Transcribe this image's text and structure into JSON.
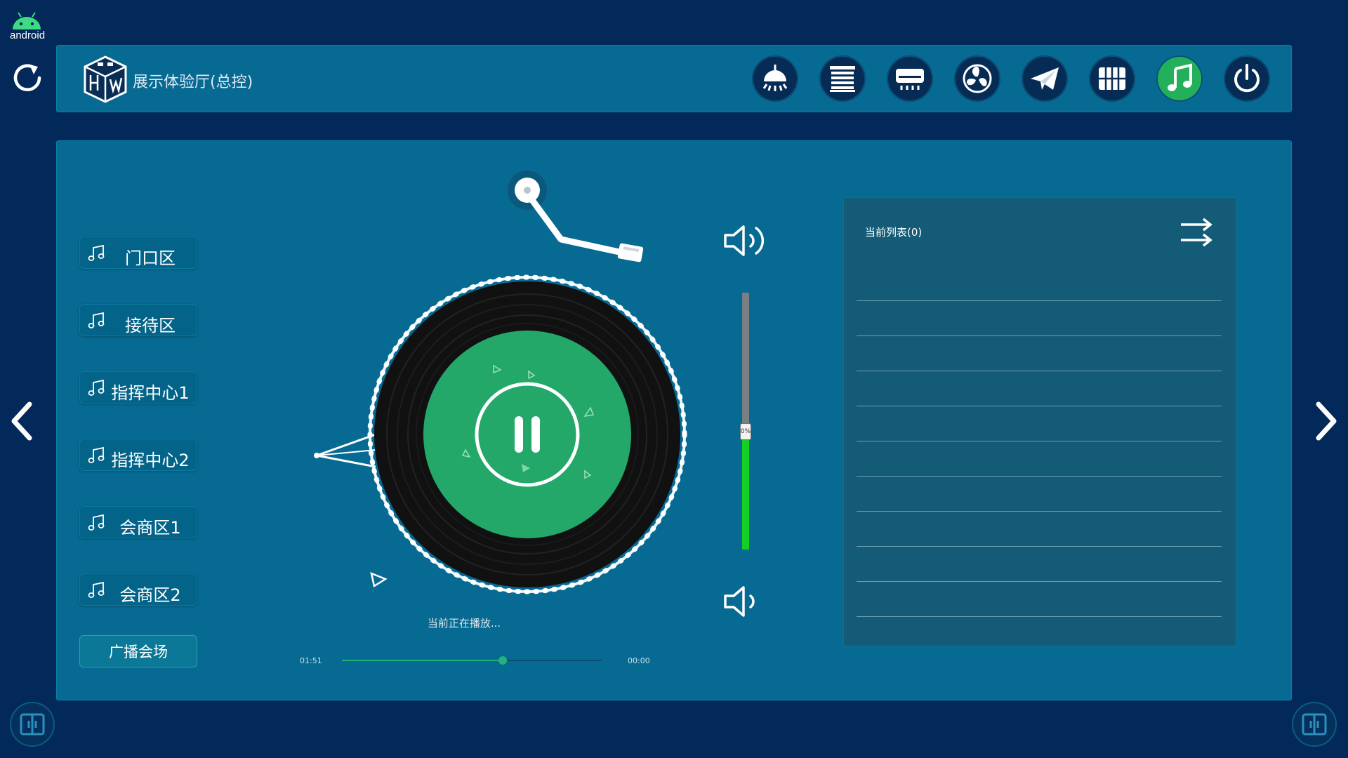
{
  "system": {
    "platform_label": "android"
  },
  "header": {
    "title": "展示体验厅(总控)",
    "nav": [
      {
        "icon": "ceiling-lamp-icon",
        "active": false
      },
      {
        "icon": "window-blind-icon",
        "active": false
      },
      {
        "icon": "air-conditioner-icon",
        "active": false
      },
      {
        "icon": "fan-icon",
        "active": false
      },
      {
        "icon": "paper-plane-icon",
        "active": false
      },
      {
        "icon": "grid-icon",
        "active": false
      },
      {
        "icon": "music-note-icon",
        "active": true
      },
      {
        "icon": "power-icon",
        "active": false
      }
    ]
  },
  "zones": [
    {
      "label": "门口区",
      "icon": "music-note-icon"
    },
    {
      "label": "接待区",
      "icon": "music-note-icon"
    },
    {
      "label": "指挥中心1",
      "icon": "music-note-icon"
    },
    {
      "label": "指挥中心2",
      "icon": "music-note-icon"
    },
    {
      "label": "会商区1",
      "icon": "music-note-icon"
    },
    {
      "label": "会商区2",
      "icon": "music-note-icon"
    }
  ],
  "broadcast": {
    "label": "广播会场"
  },
  "player": {
    "status": "当前正在播放...",
    "elapsed": "01:51",
    "total": "00:00",
    "progress": 0.62,
    "state_icon": "pause-icon"
  },
  "volume": {
    "label": "0%",
    "level": 0.46
  },
  "playlist": {
    "title": "当前列表(0)",
    "rows": 10
  },
  "colors": {
    "background": "#03285a",
    "panel": "#066a92",
    "accent_green": "#23b05b",
    "volume_fill": "#14d022"
  }
}
